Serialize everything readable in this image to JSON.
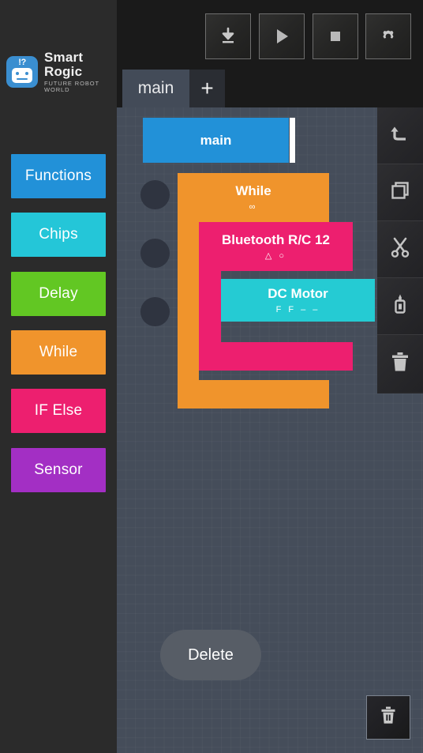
{
  "app": {
    "brand_title": "Smart Rogic",
    "brand_subtitle": "FUTURE ROBOT WORLD",
    "logo_badge": "!?"
  },
  "toolbar": {
    "buttons": [
      {
        "name": "download-button",
        "icon": "download-icon"
      },
      {
        "name": "run-button",
        "icon": "play-icon"
      },
      {
        "name": "stop-button",
        "icon": "stop-icon"
      },
      {
        "name": "settings-button",
        "icon": "gear-icon"
      }
    ]
  },
  "tabs": {
    "items": [
      {
        "label": "main",
        "active": true
      },
      {
        "label": "+",
        "active": false
      }
    ]
  },
  "palette": {
    "items": [
      {
        "label": "Functions",
        "color": "#2291d8"
      },
      {
        "label": "Chips",
        "color": "#24c6d8"
      },
      {
        "label": "Delay",
        "color": "#62c723"
      },
      {
        "label": "While",
        "color": "#f0942c"
      },
      {
        "label": "IF Else",
        "color": "#ed1f6f"
      },
      {
        "label": "Sensor",
        "color": "#a32fc4"
      }
    ]
  },
  "canvas": {
    "blocks": {
      "main": {
        "title": "main",
        "color": "#2291d8"
      },
      "while": {
        "title": "While",
        "params": "∞",
        "color": "#f0942c"
      },
      "bluetooth": {
        "title": "Bluetooth R/C 12",
        "params": "△ ○",
        "color": "#ed1f6f"
      },
      "dcmotor": {
        "title": "DC Motor",
        "params": "F  F  –  –",
        "color": "#25cbd3"
      }
    },
    "delete_button_label": "Delete"
  },
  "right_toolbar": {
    "buttons": [
      {
        "name": "undo-button",
        "icon": "undo-icon"
      },
      {
        "name": "copy-button",
        "icon": "copy-icon"
      },
      {
        "name": "cut-button",
        "icon": "scissors-icon"
      },
      {
        "name": "paste-button",
        "icon": "glue-icon"
      },
      {
        "name": "delete-button",
        "icon": "trash-icon"
      }
    ]
  },
  "fab": {
    "name": "trash-fab",
    "icon": "trash-icon"
  }
}
